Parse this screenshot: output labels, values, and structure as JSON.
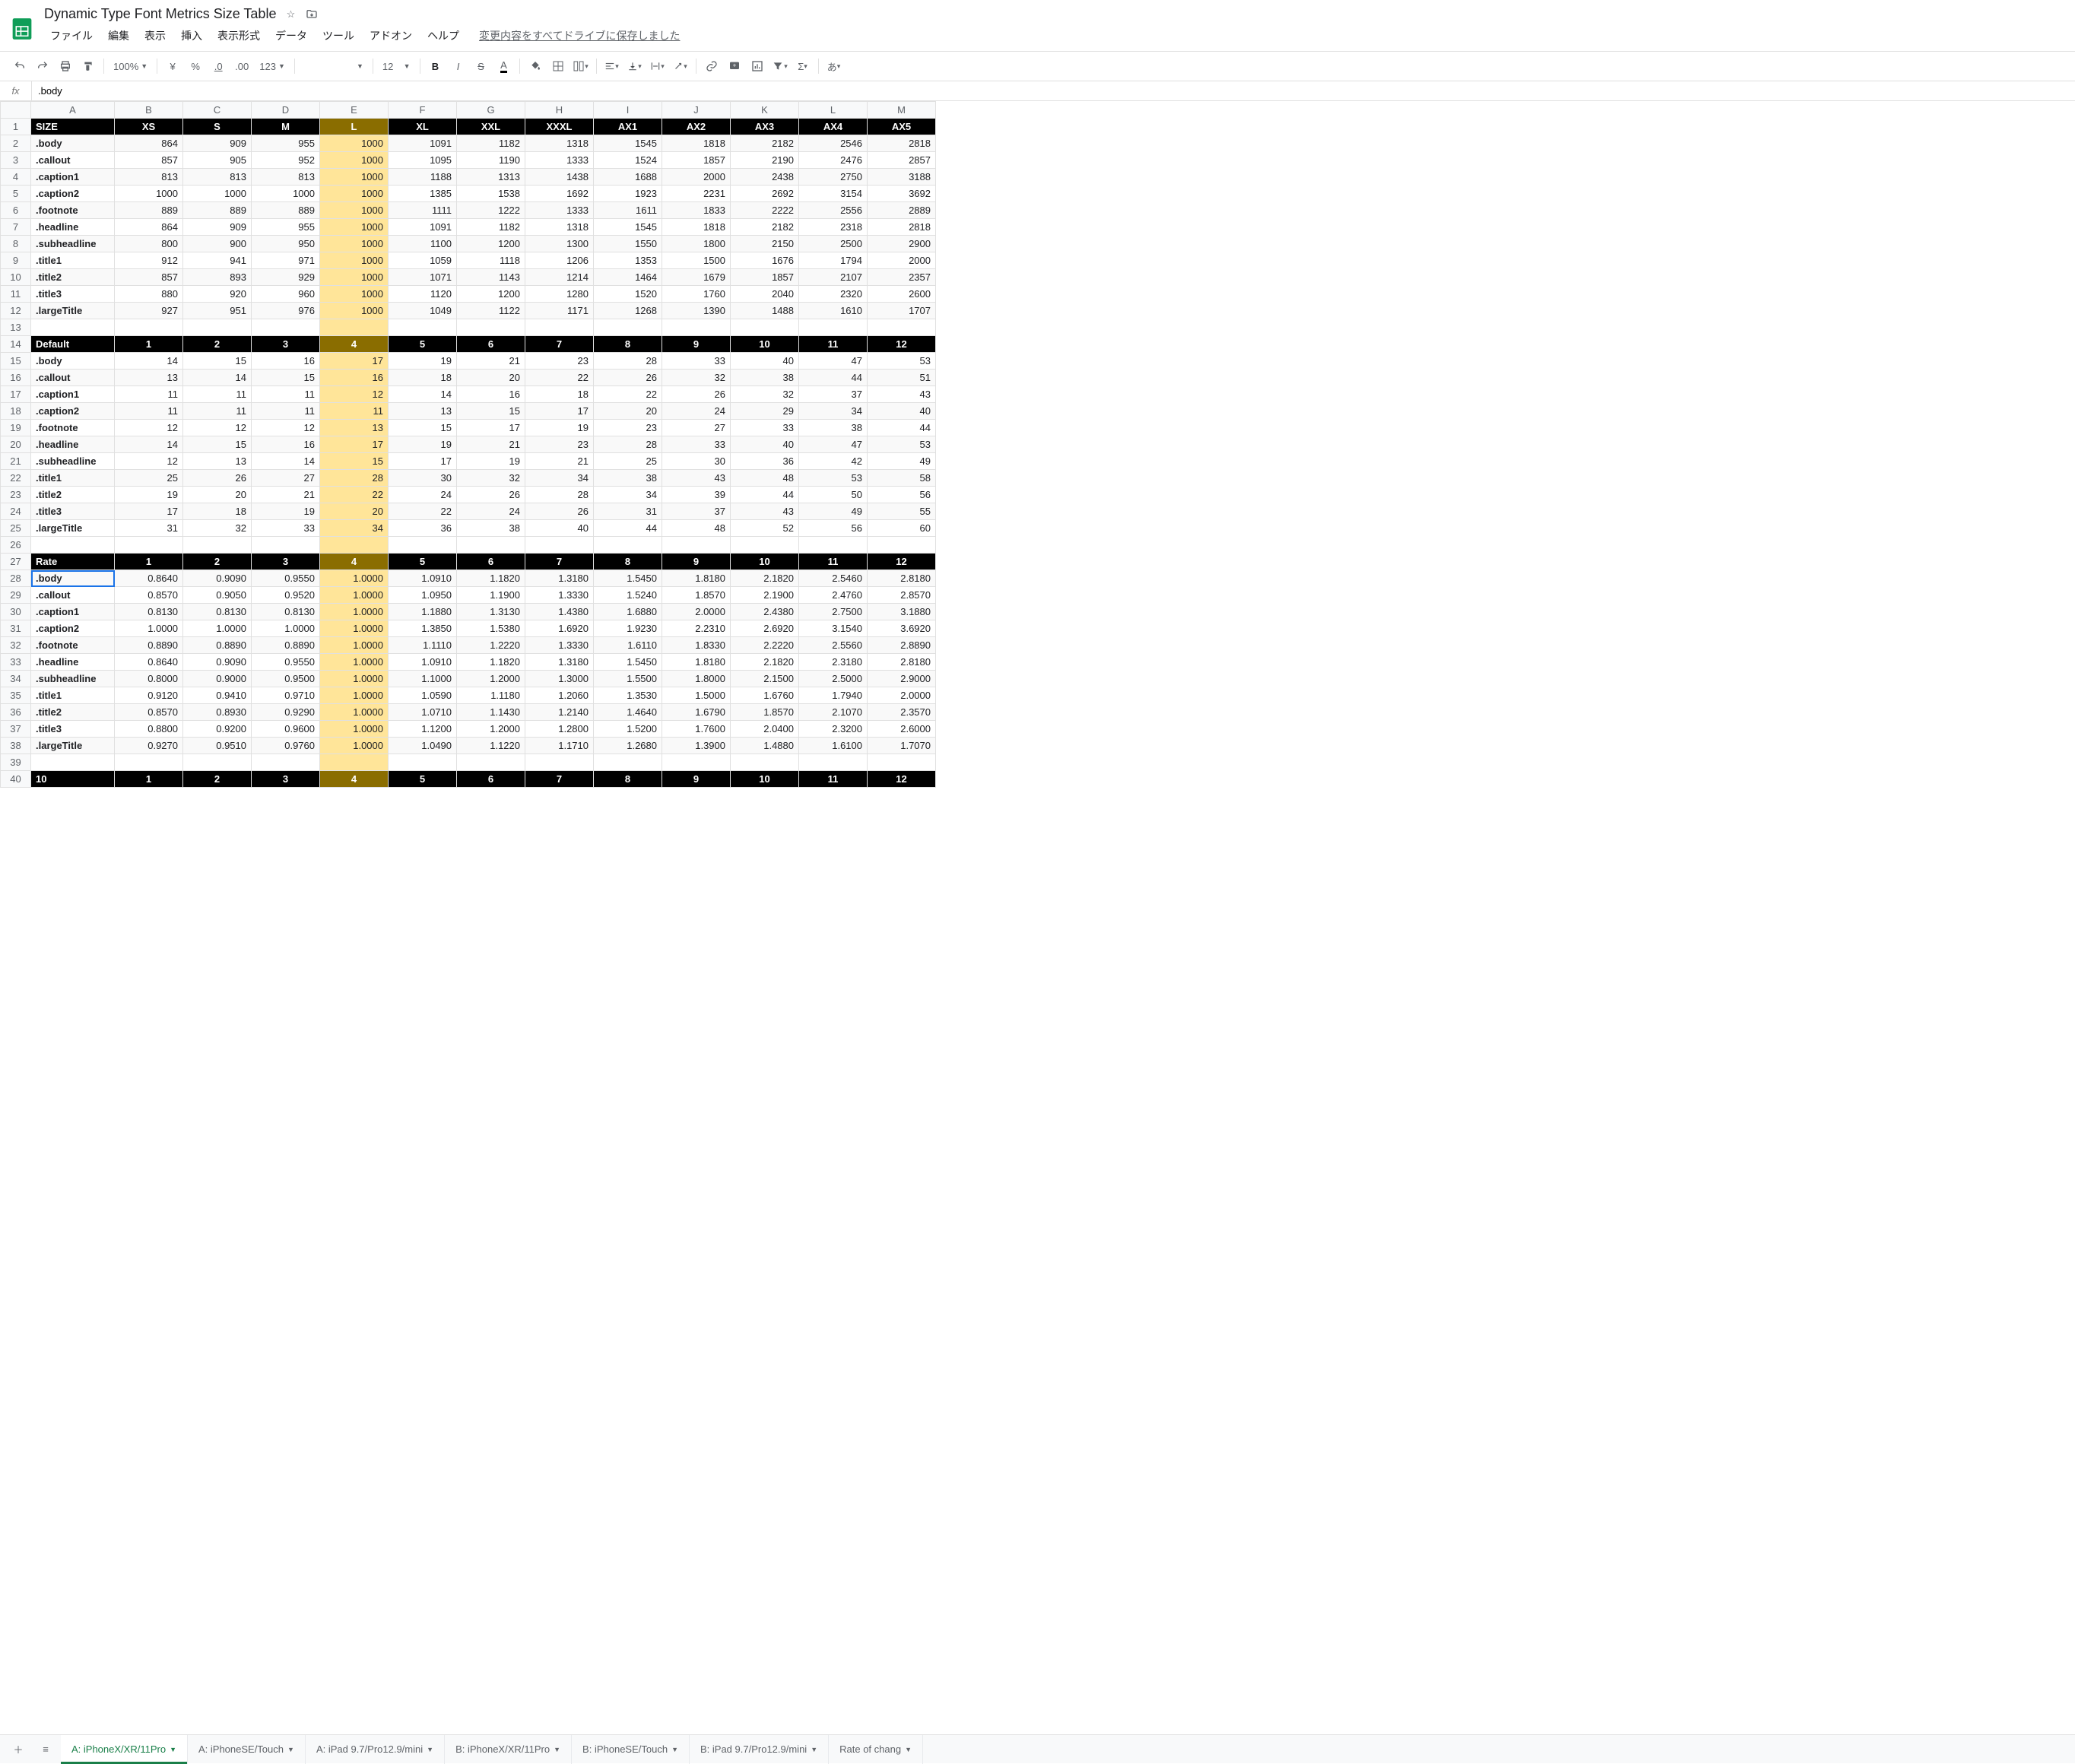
{
  "doc_title": "Dynamic Type Font Metrics Size Table",
  "menus": [
    "ファイル",
    "編集",
    "表示",
    "挿入",
    "表示形式",
    "データ",
    "ツール",
    "アドオン",
    "ヘルプ"
  ],
  "save_msg": "変更内容をすべてドライブに保存しました",
  "toolbar": {
    "zoom": "100%",
    "currency": "¥",
    "percent": "%",
    "dec_dec": ".0",
    "dec_inc": ".00",
    "more": "123",
    "font_size": "12",
    "bold": "B"
  },
  "formula_value": ".body",
  "columns": [
    "A",
    "B",
    "C",
    "D",
    "E",
    "F",
    "G",
    "H",
    "I",
    "J",
    "K",
    "L",
    "M"
  ],
  "chart_data": {
    "type": "table",
    "sections": [
      {
        "header": [
          "SIZE",
          "XS",
          "S",
          "M",
          "L",
          "XL",
          "XXL",
          "XXXL",
          "AX1",
          "AX2",
          "AX3",
          "AX4",
          "AX5"
        ],
        "rows": [
          [
            ".body",
            864,
            909,
            955,
            1000,
            1091,
            1182,
            1318,
            1545,
            1818,
            2182,
            2546,
            2818
          ],
          [
            ".callout",
            857,
            905,
            952,
            1000,
            1095,
            1190,
            1333,
            1524,
            1857,
            2190,
            2476,
            2857
          ],
          [
            ".caption1",
            813,
            813,
            813,
            1000,
            1188,
            1313,
            1438,
            1688,
            2000,
            2438,
            2750,
            3188
          ],
          [
            ".caption2",
            1000,
            1000,
            1000,
            1000,
            1385,
            1538,
            1692,
            1923,
            2231,
            2692,
            3154,
            3692
          ],
          [
            ".footnote",
            889,
            889,
            889,
            1000,
            1111,
            1222,
            1333,
            1611,
            1833,
            2222,
            2556,
            2889
          ],
          [
            ".headline",
            864,
            909,
            955,
            1000,
            1091,
            1182,
            1318,
            1545,
            1818,
            2182,
            2318,
            2818
          ],
          [
            ".subheadline",
            800,
            900,
            950,
            1000,
            1100,
            1200,
            1300,
            1550,
            1800,
            2150,
            2500,
            2900
          ],
          [
            ".title1",
            912,
            941,
            971,
            1000,
            1059,
            1118,
            1206,
            1353,
            1500,
            1676,
            1794,
            2000
          ],
          [
            ".title2",
            857,
            893,
            929,
            1000,
            1071,
            1143,
            1214,
            1464,
            1679,
            1857,
            2107,
            2357
          ],
          [
            ".title3",
            880,
            920,
            960,
            1000,
            1120,
            1200,
            1280,
            1520,
            1760,
            2040,
            2320,
            2600
          ],
          [
            ".largeTitle",
            927,
            951,
            976,
            1000,
            1049,
            1122,
            1171,
            1268,
            1390,
            1488,
            1610,
            1707
          ]
        ]
      },
      {
        "header": [
          "Default",
          "1",
          "2",
          "3",
          "4",
          "5",
          "6",
          "7",
          "8",
          "9",
          "10",
          "11",
          "12"
        ],
        "rows": [
          [
            ".body",
            14,
            15,
            16,
            17,
            19,
            21,
            23,
            28,
            33,
            40,
            47,
            53
          ],
          [
            ".callout",
            13,
            14,
            15,
            16,
            18,
            20,
            22,
            26,
            32,
            38,
            44,
            51
          ],
          [
            ".caption1",
            11,
            11,
            11,
            12,
            14,
            16,
            18,
            22,
            26,
            32,
            37,
            43
          ],
          [
            ".caption2",
            11,
            11,
            11,
            11,
            13,
            15,
            17,
            20,
            24,
            29,
            34,
            40
          ],
          [
            ".footnote",
            12,
            12,
            12,
            13,
            15,
            17,
            19,
            23,
            27,
            33,
            38,
            44
          ],
          [
            ".headline",
            14,
            15,
            16,
            17,
            19,
            21,
            23,
            28,
            33,
            40,
            47,
            53
          ],
          [
            ".subheadline",
            12,
            13,
            14,
            15,
            17,
            19,
            21,
            25,
            30,
            36,
            42,
            49
          ],
          [
            ".title1",
            25,
            26,
            27,
            28,
            30,
            32,
            34,
            38,
            43,
            48,
            53,
            58
          ],
          [
            ".title2",
            19,
            20,
            21,
            22,
            24,
            26,
            28,
            34,
            39,
            44,
            50,
            56
          ],
          [
            ".title3",
            17,
            18,
            19,
            20,
            22,
            24,
            26,
            31,
            37,
            43,
            49,
            55
          ],
          [
            ".largeTitle",
            31,
            32,
            33,
            34,
            36,
            38,
            40,
            44,
            48,
            52,
            56,
            60
          ]
        ]
      },
      {
        "header": [
          "Rate",
          "1",
          "2",
          "3",
          "4",
          "5",
          "6",
          "7",
          "8",
          "9",
          "10",
          "11",
          "12"
        ],
        "rows": [
          [
            ".body",
            "0.8640",
            "0.9090",
            "0.9550",
            "1.0000",
            "1.0910",
            "1.1820",
            "1.3180",
            "1.5450",
            "1.8180",
            "2.1820",
            "2.5460",
            "2.8180"
          ],
          [
            ".callout",
            "0.8570",
            "0.9050",
            "0.9520",
            "1.0000",
            "1.0950",
            "1.1900",
            "1.3330",
            "1.5240",
            "1.8570",
            "2.1900",
            "2.4760",
            "2.8570"
          ],
          [
            ".caption1",
            "0.8130",
            "0.8130",
            "0.8130",
            "1.0000",
            "1.1880",
            "1.3130",
            "1.4380",
            "1.6880",
            "2.0000",
            "2.4380",
            "2.7500",
            "3.1880"
          ],
          [
            ".caption2",
            "1.0000",
            "1.0000",
            "1.0000",
            "1.0000",
            "1.3850",
            "1.5380",
            "1.6920",
            "1.9230",
            "2.2310",
            "2.6920",
            "3.1540",
            "3.6920"
          ],
          [
            ".footnote",
            "0.8890",
            "0.8890",
            "0.8890",
            "1.0000",
            "1.1110",
            "1.2220",
            "1.3330",
            "1.6110",
            "1.8330",
            "2.2220",
            "2.5560",
            "2.8890"
          ],
          [
            ".headline",
            "0.8640",
            "0.9090",
            "0.9550",
            "1.0000",
            "1.0910",
            "1.1820",
            "1.3180",
            "1.5450",
            "1.8180",
            "2.1820",
            "2.3180",
            "2.8180"
          ],
          [
            ".subheadline",
            "0.8000",
            "0.9000",
            "0.9500",
            "1.0000",
            "1.1000",
            "1.2000",
            "1.3000",
            "1.5500",
            "1.8000",
            "2.1500",
            "2.5000",
            "2.9000"
          ],
          [
            ".title1",
            "0.9120",
            "0.9410",
            "0.9710",
            "1.0000",
            "1.0590",
            "1.1180",
            "1.2060",
            "1.3530",
            "1.5000",
            "1.6760",
            "1.7940",
            "2.0000"
          ],
          [
            ".title2",
            "0.8570",
            "0.8930",
            "0.9290",
            "1.0000",
            "1.0710",
            "1.1430",
            "1.2140",
            "1.4640",
            "1.6790",
            "1.8570",
            "2.1070",
            "2.3570"
          ],
          [
            ".title3",
            "0.8800",
            "0.9200",
            "0.9600",
            "1.0000",
            "1.1200",
            "1.2000",
            "1.2800",
            "1.5200",
            "1.7600",
            "2.0400",
            "2.3200",
            "2.6000"
          ],
          [
            ".largeTitle",
            "0.9270",
            "0.9510",
            "0.9760",
            "1.0000",
            "1.0490",
            "1.1220",
            "1.1710",
            "1.2680",
            "1.3900",
            "1.4880",
            "1.6100",
            "1.7070"
          ]
        ]
      },
      {
        "header": [
          "10",
          "1",
          "2",
          "3",
          "4",
          "5",
          "6",
          "7",
          "8",
          "9",
          "10",
          "11",
          "12"
        ],
        "rows": []
      }
    ]
  },
  "selected_cell": {
    "row": 28,
    "col": "A",
    "value": ".body"
  },
  "tabs": [
    "A: iPhoneX/XR/11Pro",
    "A: iPhoneSE/Touch",
    "A: iPad 9.7/Pro12.9/mini",
    "B: iPhoneX/XR/11Pro",
    "B: iPhoneSE/Touch",
    "B: iPad 9.7/Pro12.9/mini",
    "Rate of chang"
  ],
  "active_tab": 0
}
